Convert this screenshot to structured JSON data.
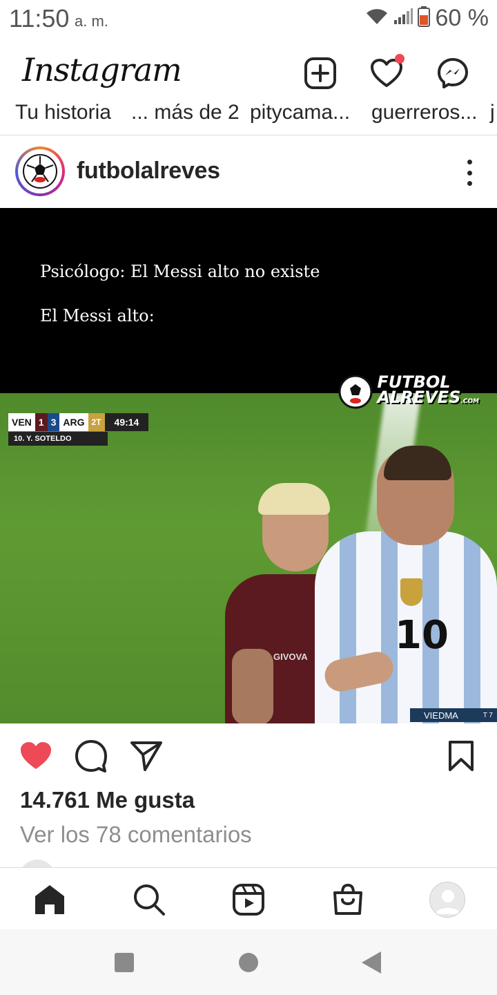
{
  "status_bar": {
    "time": "11:50",
    "ampm": "a. m.",
    "battery": "60 %",
    "battery_color": "#e0542a"
  },
  "header": {
    "logo": "Instagram",
    "icons": [
      "new-post-icon",
      "heart-icon",
      "messenger-icon"
    ],
    "notification_color": "#ed4956"
  },
  "stories": {
    "labels": [
      "Tu historia",
      "... más de 2",
      "pitycama...",
      "guerreros...",
      "j"
    ]
  },
  "post": {
    "username": "futbolalreves",
    "image": {
      "caption_line_1": "Psicólogo: El Messi alto no existe",
      "caption_line_2": "El Messi alto:",
      "watermark_line_1": "FUTBOL",
      "watermark_line_2": "ALREVES",
      "watermark_suffix": ".COM",
      "scorebug": {
        "home": "VEN",
        "home_score": "1",
        "away_score": "3",
        "away": "ARG",
        "period": "2T",
        "clock": "49:14",
        "player": "10. Y. SOTELDO"
      },
      "sponsor": "GIVOVA",
      "shirt_number": "10",
      "channel_tag": "VIEDMA",
      "channel_tag_suffix": "T 7"
    },
    "liked": true,
    "like_color": "#ed4956",
    "likes_text": "14.761 Me gusta",
    "comments_text": "Ver los 78 comentarios"
  },
  "tabbar": {
    "items": [
      "home-icon",
      "search-icon",
      "reels-icon",
      "shop-icon",
      "profile-avatar"
    ]
  },
  "android_nav": {
    "items": [
      "recents-button",
      "home-button",
      "back-button"
    ]
  }
}
